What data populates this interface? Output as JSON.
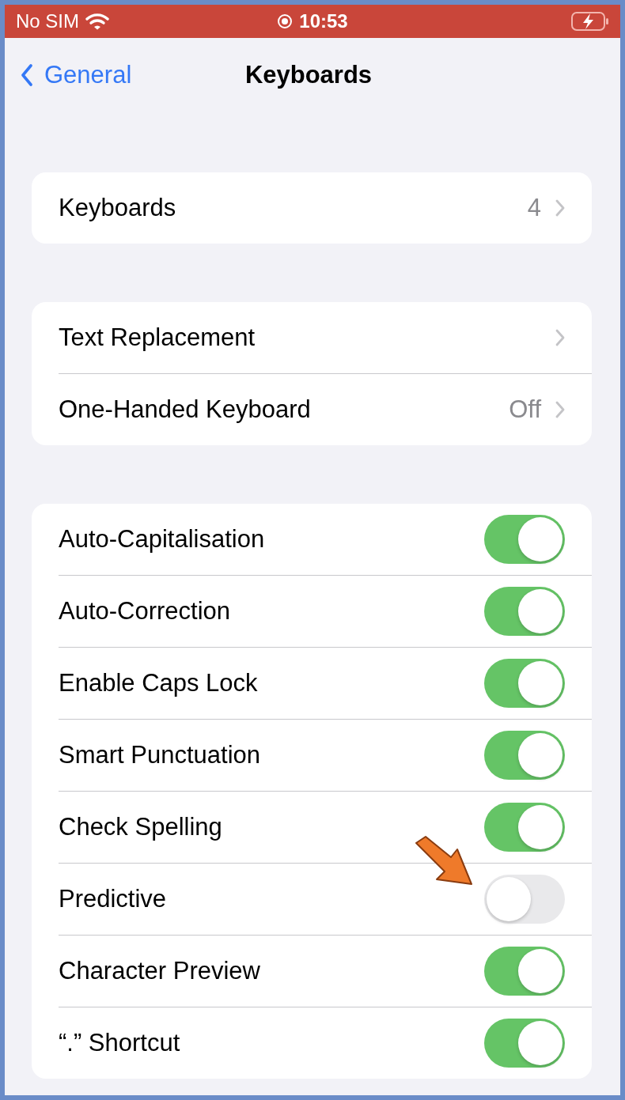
{
  "status_bar": {
    "carrier": "No SIM",
    "time": "10:53"
  },
  "nav": {
    "back": "General",
    "title": "Keyboards"
  },
  "groups": [
    {
      "rows": [
        {
          "kind": "link",
          "label": "Keyboards",
          "value": "4"
        }
      ]
    },
    {
      "rows": [
        {
          "kind": "link",
          "label": "Text Replacement"
        },
        {
          "kind": "link",
          "label": "One-Handed Keyboard",
          "value": "Off"
        }
      ]
    },
    {
      "rows": [
        {
          "kind": "toggle",
          "label": "Auto-Capitalisation",
          "on": true
        },
        {
          "kind": "toggle",
          "label": "Auto-Correction",
          "on": true
        },
        {
          "kind": "toggle",
          "label": "Enable Caps Lock",
          "on": true
        },
        {
          "kind": "toggle",
          "label": "Smart Punctuation",
          "on": true
        },
        {
          "kind": "toggle",
          "label": "Check Spelling",
          "on": true
        },
        {
          "kind": "toggle",
          "label": "Predictive",
          "on": false,
          "pointer": true
        },
        {
          "kind": "toggle",
          "label": "Character Preview",
          "on": true
        },
        {
          "kind": "toggle",
          "label": "“.” Shortcut",
          "on": true
        }
      ]
    }
  ]
}
